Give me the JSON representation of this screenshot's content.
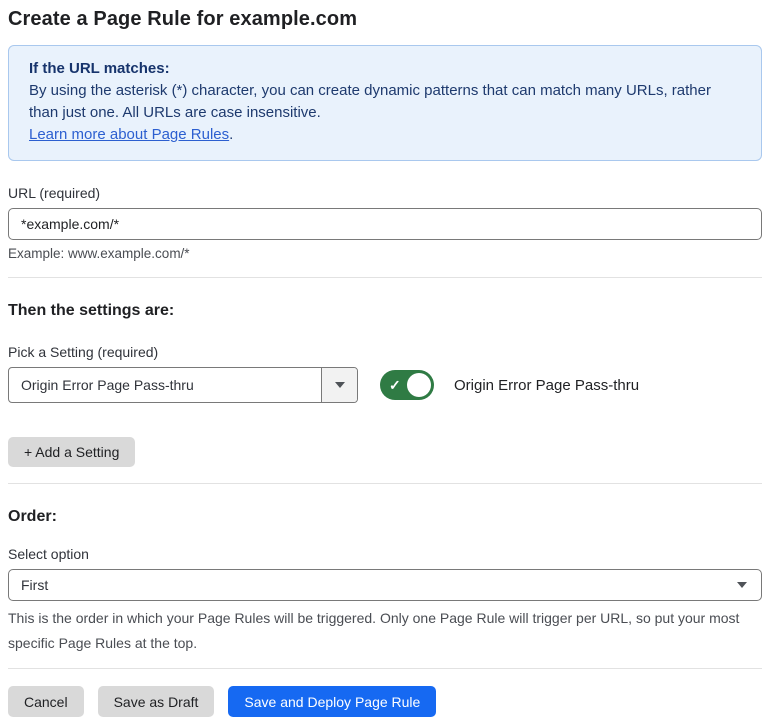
{
  "page_title": "Create a Page Rule for example.com",
  "info_box": {
    "heading": "If the URL matches:",
    "body": "By using the asterisk (*) character, you can create dynamic patterns that can match many URLs, rather than just one. All URLs are case insensitive.",
    "link_label": "Learn more about Page Rules",
    "link_suffix": "."
  },
  "url_field": {
    "label": "URL (required)",
    "value": "*example.com/*",
    "helper": "Example: www.example.com/*"
  },
  "settings_section": {
    "heading": "Then the settings are:",
    "picker_label": "Pick a Setting (required)",
    "picker_value": "Origin Error Page Pass-thru",
    "toggle_state": "on",
    "toggle_check": "✓",
    "toggle_label": "Origin Error Page Pass-thru",
    "add_setting_label": "+ Add a Setting"
  },
  "order_section": {
    "heading": "Order:",
    "select_label": "Select option",
    "select_value": "First",
    "helper": "This is the order in which your Page Rules will be triggered. Only one Page Rule will trigger per URL, so put your most specific Page Rules at the top."
  },
  "footer": {
    "cancel_label": "Cancel",
    "save_draft_label": "Save as Draft",
    "save_deploy_label": "Save and Deploy Page Rule"
  },
  "colors": {
    "accent_blue": "#1669F2",
    "info_background": "#E9F2FC",
    "info_border": "#A9C8EE",
    "info_text": "#1E3A6E",
    "link_blue": "#2C5FD0",
    "toggle_green": "#2F7B44",
    "button_gray": "#D9D9D9"
  }
}
